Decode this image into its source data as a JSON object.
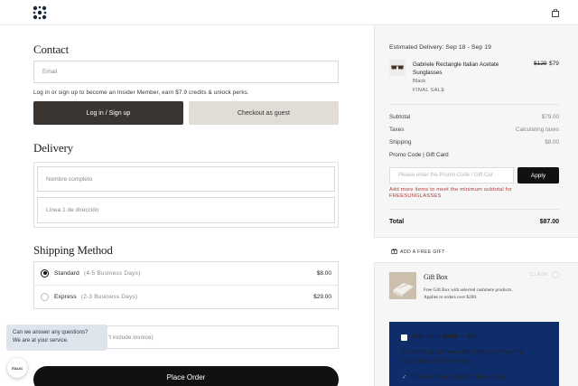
{
  "header": {
    "logo": "logo-mark",
    "cart_icon": "shopping-bag-icon"
  },
  "contact": {
    "title": "Contact",
    "email_placeholder": "Email",
    "login_note": "Log in or sign up to become an Insider Member, earn $7.9 credits & unlock perks.",
    "login_button": "Log in / Sign up",
    "guest_button": "Checkout as guest"
  },
  "delivery": {
    "title": "Delivery",
    "name_placeholder": "Nombre completo",
    "address_placeholder": "Línea 1 de dirección"
  },
  "shipping": {
    "title": "Shipping Method",
    "options": [
      {
        "name": "Standard",
        "eta": "(4-5 Business Days)",
        "price": "$8.00",
        "selected": true
      },
      {
        "name": "Express",
        "eta": "(2-3 Business Days)",
        "price": "$29.00",
        "selected": false
      }
    ]
  },
  "invoice_partial": "'t include invoice)",
  "chat": {
    "line1": "Can we answer any questions?",
    "line2": "We are at your service.",
    "avatar_text": "ITALIC"
  },
  "place_order": "Place Order",
  "summary": {
    "estimated_delivery": "Estimated Delivery:  Sep 18 - Sep 19",
    "product": {
      "name": "Gabriele Rectangle Italian Acetate Sunglasses",
      "color": "Black",
      "tag": "FINAL SALE",
      "old_price": "$129",
      "new_price": "$79"
    },
    "lines": [
      {
        "label": "Subtotal",
        "value": "$79.00"
      },
      {
        "label": "Taxes",
        "value": "Calculating taxes"
      },
      {
        "label": "Shipping",
        "value": "$8.00"
      }
    ],
    "promo_label": "Promo Code | Gift Card",
    "promo_placeholder": "Please enter the Promo Code / Gift Car",
    "apply_button": "Apply",
    "promo_error": "Add more items to meet the minimum subtotal for FREESUNGLASSES",
    "total_label": "Total",
    "total_value": "$87.00"
  },
  "gift": {
    "add_label": "ADD A FREE GIFT",
    "title": "Gift Box",
    "desc": "Free Gift Box with selected cashmere products. Applies to orders over $200.",
    "claim": "CLAIM"
  },
  "join": {
    "title": "Join Italic Bold — $60",
    "body": "Get a free gift and save $30 right now. Recurring subscription, billed annually.",
    "bonus": "The Bold Bonus: $120 in Italic Credit"
  },
  "colors": {
    "accent_dark": "#111111",
    "join_bg": "#0f2d6b",
    "error": "#b23a3a",
    "guest_bg": "#e1ddd6"
  }
}
